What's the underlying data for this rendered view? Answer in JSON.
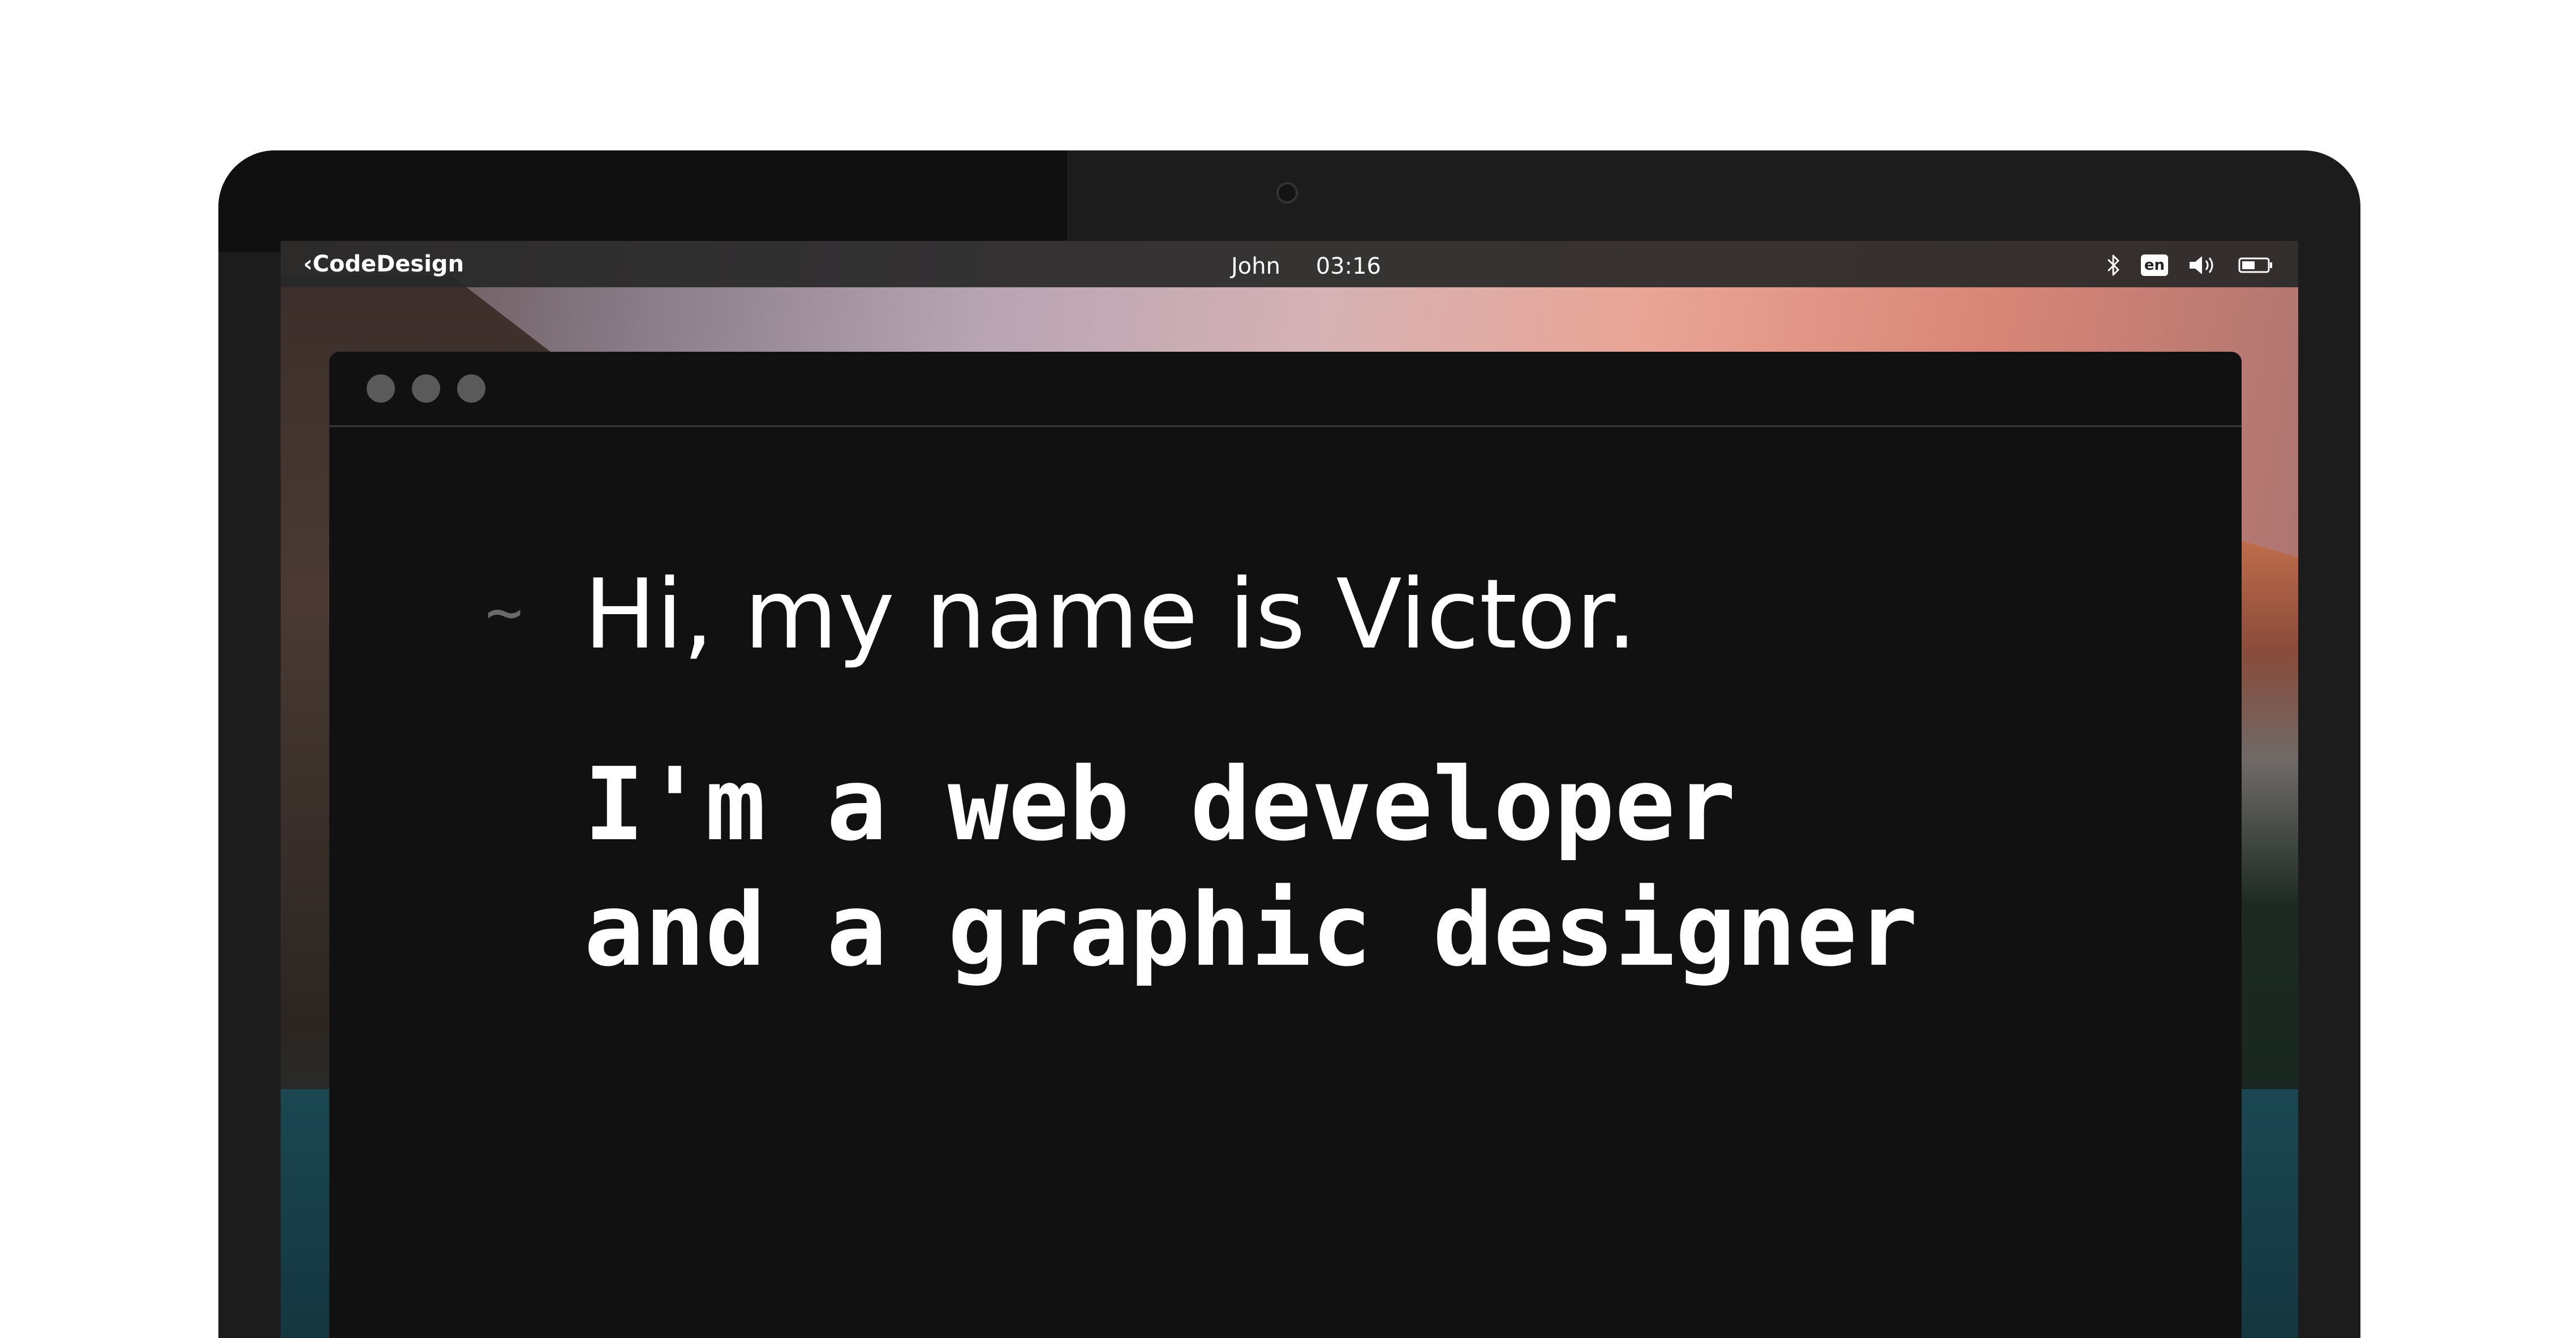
{
  "menubar": {
    "brand": "‹CodeDesign",
    "user": "John",
    "time": "03:16",
    "tray": {
      "bluetooth_icon": "bluetooth-icon",
      "language": "en",
      "volume_icon": "volume-icon",
      "battery_icon": "battery-icon"
    }
  },
  "terminal": {
    "prompt": "~",
    "greeting": "Hi, my name is Victor.",
    "tagline_line1": "I'm a web developer",
    "tagline_line2": "and a graphic designer"
  },
  "colors": {
    "bezel": "#1c1c1c",
    "terminal_bg": "#111111",
    "window_dots": "#5a5a5a",
    "prompt": "#6a6a6a",
    "text": "#ffffff"
  }
}
